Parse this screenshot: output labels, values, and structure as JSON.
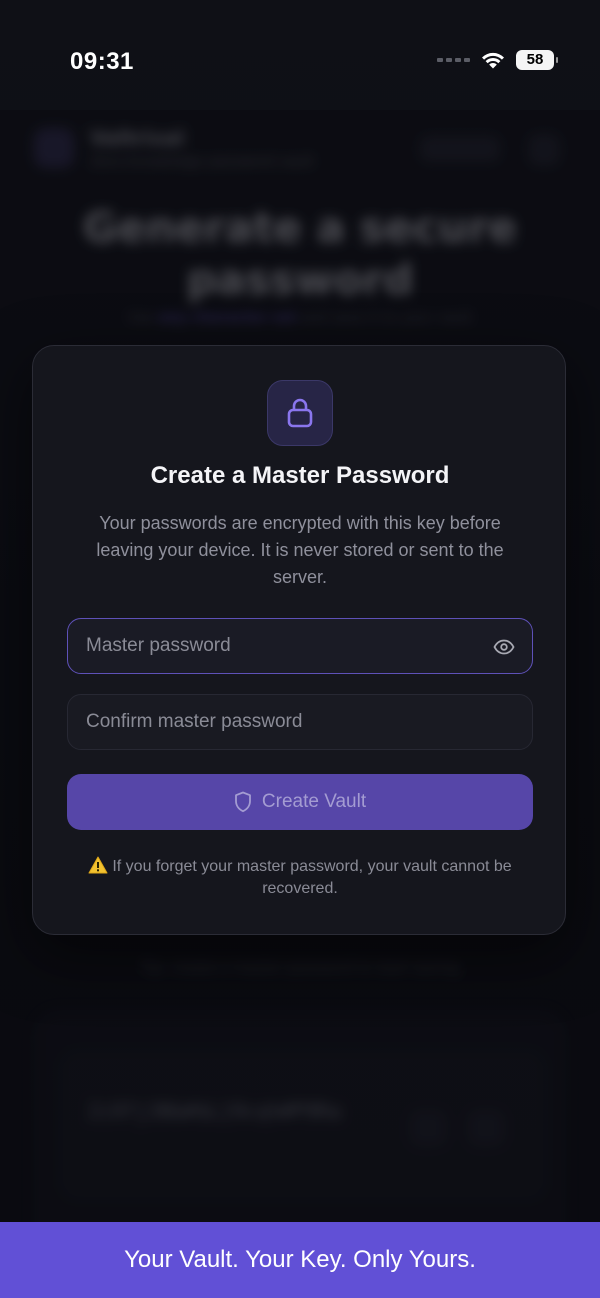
{
  "status_bar": {
    "time": "09:31",
    "battery": "58"
  },
  "background": {
    "brand_name": "Valtrixal",
    "brand_tagline": "Zero-knowledge password vault",
    "hero_title": "Generate a secure password",
    "hero_subtitle_prefix": "Use ",
    "hero_subtitle_link": "any character set",
    "hero_subtitle_suffix": " and save it to your vault",
    "note": "Tip: create a master password to start saving",
    "sample_password": "2i97j3B&#$L}9cq%#P9Ra"
  },
  "modal": {
    "title": "Create a Master Password",
    "description": "Your passwords are encrypted with this key before leaving your device. It is never stored or sent to the server.",
    "master_password": {
      "value": "",
      "placeholder": "Master password"
    },
    "confirm_password": {
      "value": "",
      "placeholder": "Confirm master password"
    },
    "create_button_label": "Create Vault",
    "warning": "If you forget your master password, your vault cannot be recovered.",
    "icons": {
      "badge": "lock-icon",
      "toggle": "eye-icon",
      "button": "shield-icon",
      "warning": "warning-icon"
    }
  },
  "banner": {
    "text": "Your Vault. Your Key. Only Yours."
  },
  "colors": {
    "accent": "#6150d6",
    "button": "#5646a8",
    "focus_border": "#5e51b8"
  }
}
